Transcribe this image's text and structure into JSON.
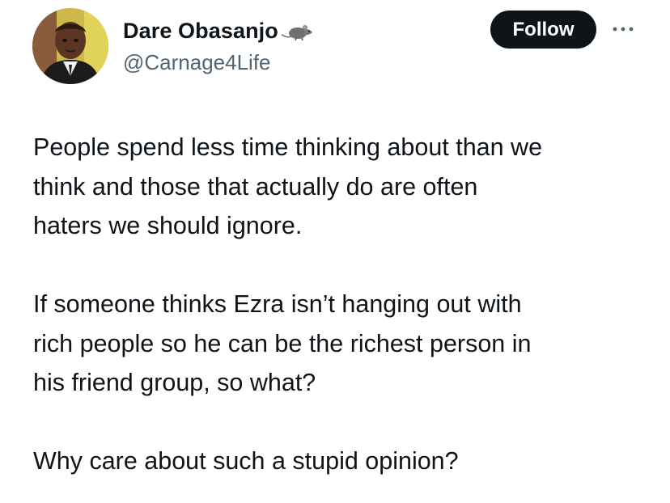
{
  "author": {
    "display_name": "Dare Obasanjo",
    "handle": "@Carnage4Life",
    "badge_icon": "rat-icon",
    "avatar_icon": "profile-photo"
  },
  "actions": {
    "follow_label": "Follow",
    "more_icon": "more-dots-icon"
  },
  "colors": {
    "text_primary": "#0f1419",
    "text_secondary": "#536471",
    "follow_bg": "#0f1419",
    "follow_text": "#ffffff",
    "background": "#ffffff"
  },
  "tweet": {
    "paragraphs": [
      "People spend less time thinking about than we\nthink and those that actually do are often\nhaters we should ignore.",
      "If someone thinks Ezra isn’t hanging out with\nrich people so he can be the richest person in\nhis friend group, so what?",
      "Why care about such a stupid opinion?"
    ]
  }
}
